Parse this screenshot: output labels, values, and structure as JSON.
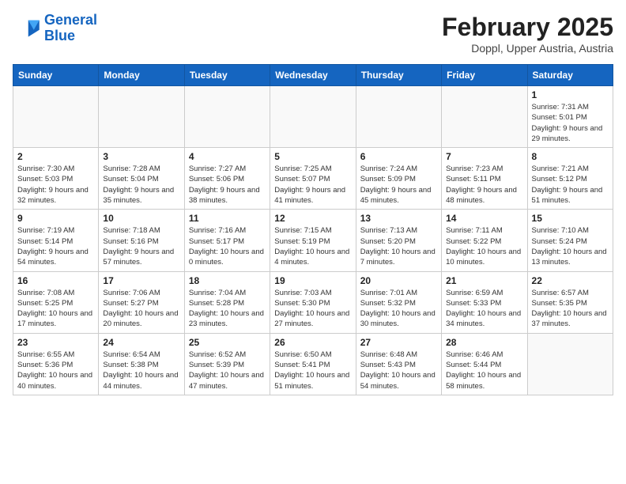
{
  "logo": {
    "line1": "General",
    "line2": "Blue"
  },
  "title": "February 2025",
  "subtitle": "Doppl, Upper Austria, Austria",
  "weekdays": [
    "Sunday",
    "Monday",
    "Tuesday",
    "Wednesday",
    "Thursday",
    "Friday",
    "Saturday"
  ],
  "weeks": [
    [
      {
        "day": "",
        "info": ""
      },
      {
        "day": "",
        "info": ""
      },
      {
        "day": "",
        "info": ""
      },
      {
        "day": "",
        "info": ""
      },
      {
        "day": "",
        "info": ""
      },
      {
        "day": "",
        "info": ""
      },
      {
        "day": "1",
        "info": "Sunrise: 7:31 AM\nSunset: 5:01 PM\nDaylight: 9 hours and 29 minutes."
      }
    ],
    [
      {
        "day": "2",
        "info": "Sunrise: 7:30 AM\nSunset: 5:03 PM\nDaylight: 9 hours and 32 minutes."
      },
      {
        "day": "3",
        "info": "Sunrise: 7:28 AM\nSunset: 5:04 PM\nDaylight: 9 hours and 35 minutes."
      },
      {
        "day": "4",
        "info": "Sunrise: 7:27 AM\nSunset: 5:06 PM\nDaylight: 9 hours and 38 minutes."
      },
      {
        "day": "5",
        "info": "Sunrise: 7:25 AM\nSunset: 5:07 PM\nDaylight: 9 hours and 41 minutes."
      },
      {
        "day": "6",
        "info": "Sunrise: 7:24 AM\nSunset: 5:09 PM\nDaylight: 9 hours and 45 minutes."
      },
      {
        "day": "7",
        "info": "Sunrise: 7:23 AM\nSunset: 5:11 PM\nDaylight: 9 hours and 48 minutes."
      },
      {
        "day": "8",
        "info": "Sunrise: 7:21 AM\nSunset: 5:12 PM\nDaylight: 9 hours and 51 minutes."
      }
    ],
    [
      {
        "day": "9",
        "info": "Sunrise: 7:19 AM\nSunset: 5:14 PM\nDaylight: 9 hours and 54 minutes."
      },
      {
        "day": "10",
        "info": "Sunrise: 7:18 AM\nSunset: 5:16 PM\nDaylight: 9 hours and 57 minutes."
      },
      {
        "day": "11",
        "info": "Sunrise: 7:16 AM\nSunset: 5:17 PM\nDaylight: 10 hours and 0 minutes."
      },
      {
        "day": "12",
        "info": "Sunrise: 7:15 AM\nSunset: 5:19 PM\nDaylight: 10 hours and 4 minutes."
      },
      {
        "day": "13",
        "info": "Sunrise: 7:13 AM\nSunset: 5:20 PM\nDaylight: 10 hours and 7 minutes."
      },
      {
        "day": "14",
        "info": "Sunrise: 7:11 AM\nSunset: 5:22 PM\nDaylight: 10 hours and 10 minutes."
      },
      {
        "day": "15",
        "info": "Sunrise: 7:10 AM\nSunset: 5:24 PM\nDaylight: 10 hours and 13 minutes."
      }
    ],
    [
      {
        "day": "16",
        "info": "Sunrise: 7:08 AM\nSunset: 5:25 PM\nDaylight: 10 hours and 17 minutes."
      },
      {
        "day": "17",
        "info": "Sunrise: 7:06 AM\nSunset: 5:27 PM\nDaylight: 10 hours and 20 minutes."
      },
      {
        "day": "18",
        "info": "Sunrise: 7:04 AM\nSunset: 5:28 PM\nDaylight: 10 hours and 23 minutes."
      },
      {
        "day": "19",
        "info": "Sunrise: 7:03 AM\nSunset: 5:30 PM\nDaylight: 10 hours and 27 minutes."
      },
      {
        "day": "20",
        "info": "Sunrise: 7:01 AM\nSunset: 5:32 PM\nDaylight: 10 hours and 30 minutes."
      },
      {
        "day": "21",
        "info": "Sunrise: 6:59 AM\nSunset: 5:33 PM\nDaylight: 10 hours and 34 minutes."
      },
      {
        "day": "22",
        "info": "Sunrise: 6:57 AM\nSunset: 5:35 PM\nDaylight: 10 hours and 37 minutes."
      }
    ],
    [
      {
        "day": "23",
        "info": "Sunrise: 6:55 AM\nSunset: 5:36 PM\nDaylight: 10 hours and 40 minutes."
      },
      {
        "day": "24",
        "info": "Sunrise: 6:54 AM\nSunset: 5:38 PM\nDaylight: 10 hours and 44 minutes."
      },
      {
        "day": "25",
        "info": "Sunrise: 6:52 AM\nSunset: 5:39 PM\nDaylight: 10 hours and 47 minutes."
      },
      {
        "day": "26",
        "info": "Sunrise: 6:50 AM\nSunset: 5:41 PM\nDaylight: 10 hours and 51 minutes."
      },
      {
        "day": "27",
        "info": "Sunrise: 6:48 AM\nSunset: 5:43 PM\nDaylight: 10 hours and 54 minutes."
      },
      {
        "day": "28",
        "info": "Sunrise: 6:46 AM\nSunset: 5:44 PM\nDaylight: 10 hours and 58 minutes."
      },
      {
        "day": "",
        "info": ""
      }
    ]
  ]
}
